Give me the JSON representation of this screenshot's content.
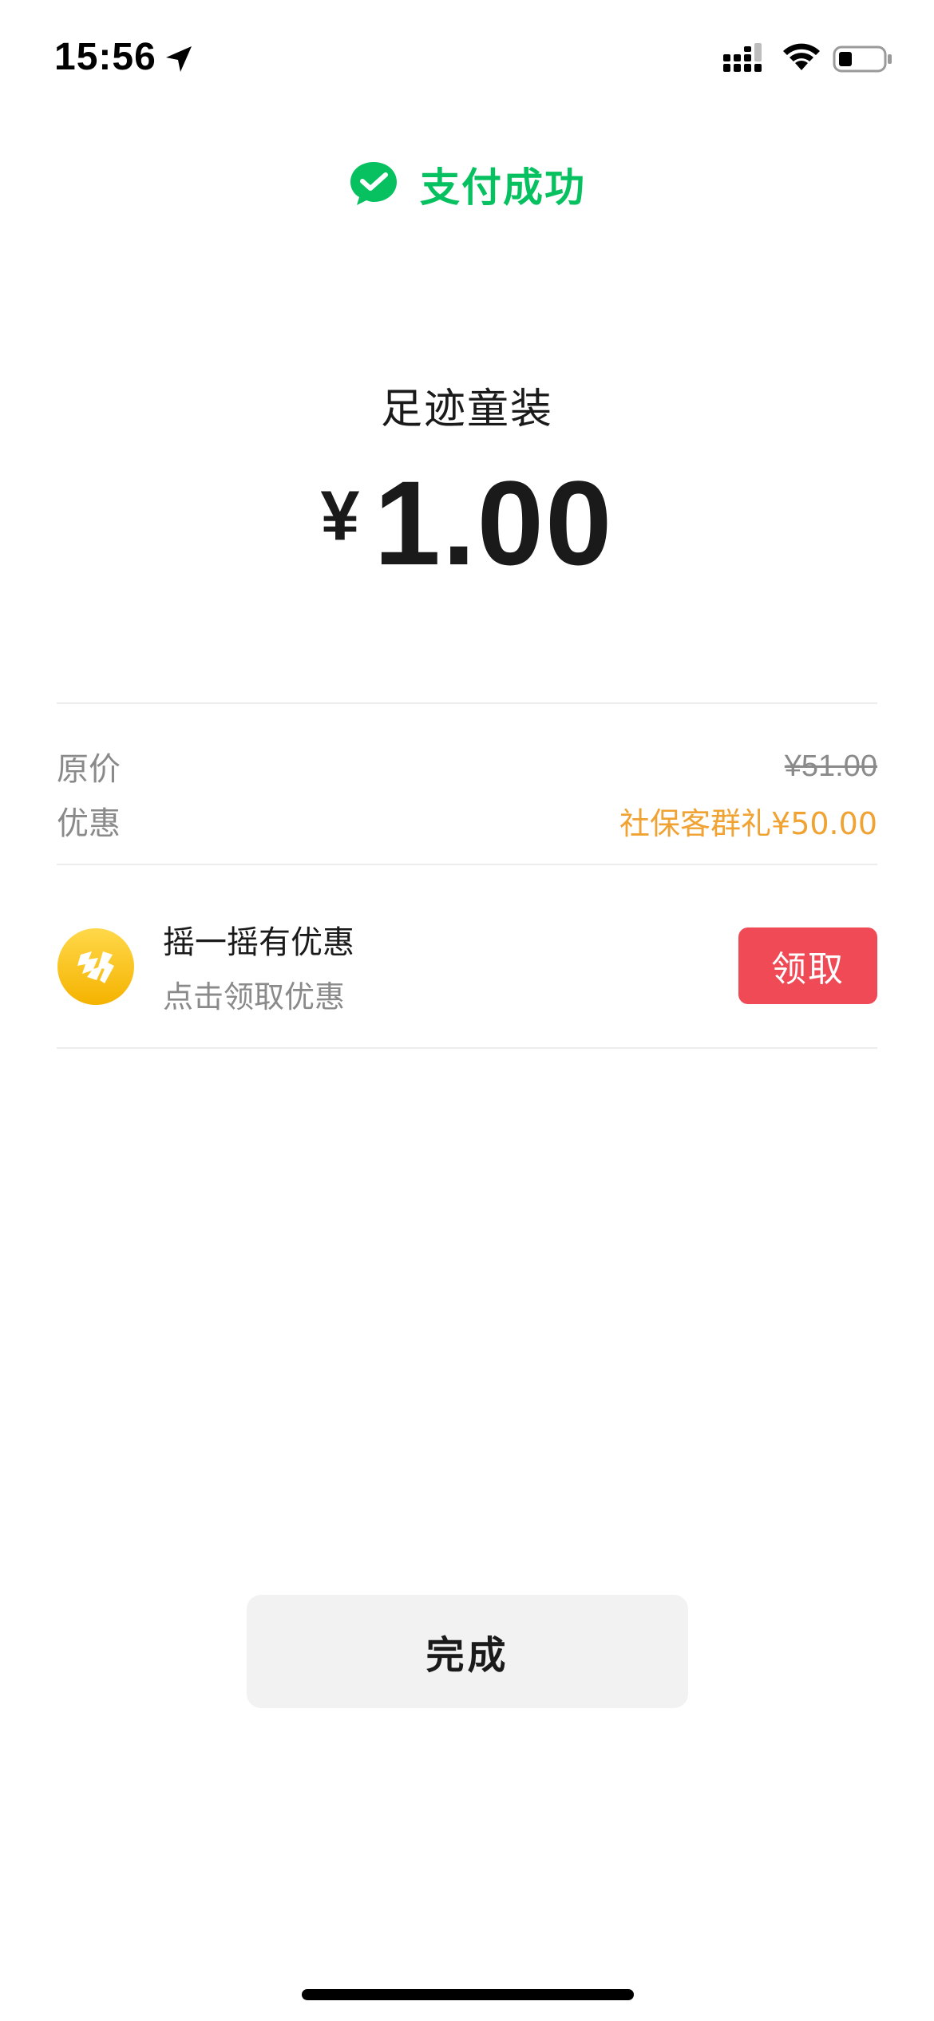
{
  "status_bar": {
    "time": "15:56",
    "icons": [
      "location-arrow-icon",
      "signal-icon",
      "wifi-icon",
      "battery-icon"
    ]
  },
  "header": {
    "icon": "wechat-pay-icon",
    "success_text": "支付成功",
    "accent_color": "#07c160"
  },
  "payment": {
    "merchant": "足迹童装",
    "currency_symbol": "¥",
    "amount": "1.00"
  },
  "price_details": {
    "original_label": "原价",
    "original_value": "¥51.00",
    "discount_label": "优惠",
    "discount_value": "社保客群礼¥50.00",
    "discount_color": "#f0a232"
  },
  "promo": {
    "icon": "shake-coupon-icon",
    "title": "摇一摇有优惠",
    "subtitle": "点击领取优惠",
    "button_label": "领取",
    "button_color": "#f04a57"
  },
  "actions": {
    "done_label": "完成"
  }
}
